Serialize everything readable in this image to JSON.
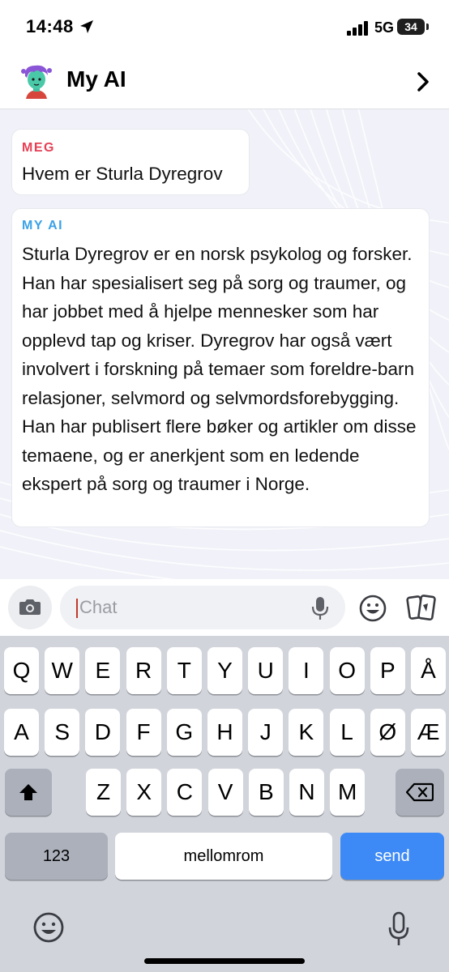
{
  "status_bar": {
    "time": "14:48",
    "network": "5G",
    "battery": "34"
  },
  "header": {
    "title": "My AI"
  },
  "messages": [
    {
      "sender": "MEG",
      "text": "Hvem er Sturla Dyregrov"
    },
    {
      "sender": "MY AI",
      "text": "Sturla Dyregrov er en norsk psykolog og forsker. Han har spesialisert seg på sorg og traumer, og har jobbet med å hjelpe mennesker som har opplevd tap og kriser. Dyregrov har også vært involvert i forskning på temaer som foreldre-barn relasjoner, selvmord og selvmordsforebygging. Han har publisert flere bøker og artikler om disse temaene, og er anerkjent som en ledende ekspert på sorg og traumer i Norge."
    }
  ],
  "input": {
    "placeholder": "Chat"
  },
  "keyboard": {
    "row1": [
      "Q",
      "W",
      "E",
      "R",
      "T",
      "Y",
      "U",
      "I",
      "O",
      "P",
      "Å"
    ],
    "row2": [
      "A",
      "S",
      "D",
      "F",
      "G",
      "H",
      "J",
      "K",
      "L",
      "Ø",
      "Æ"
    ],
    "row3": [
      "Z",
      "X",
      "C",
      "V",
      "B",
      "N",
      "M"
    ],
    "numbers_label": "123",
    "space_label": "mellomrom",
    "send_label": "send"
  },
  "colors": {
    "me_label": "#e63f54",
    "ai_label": "#3aa2e6",
    "send_key": "#3d8af7"
  },
  "icons": [
    "location-arrow-icon",
    "signal-icon",
    "battery-icon",
    "avatar",
    "chevron-right-icon",
    "camera-icon",
    "microphone-icon",
    "emoji-icon",
    "cards-icon",
    "shift-icon",
    "backspace-icon"
  ]
}
